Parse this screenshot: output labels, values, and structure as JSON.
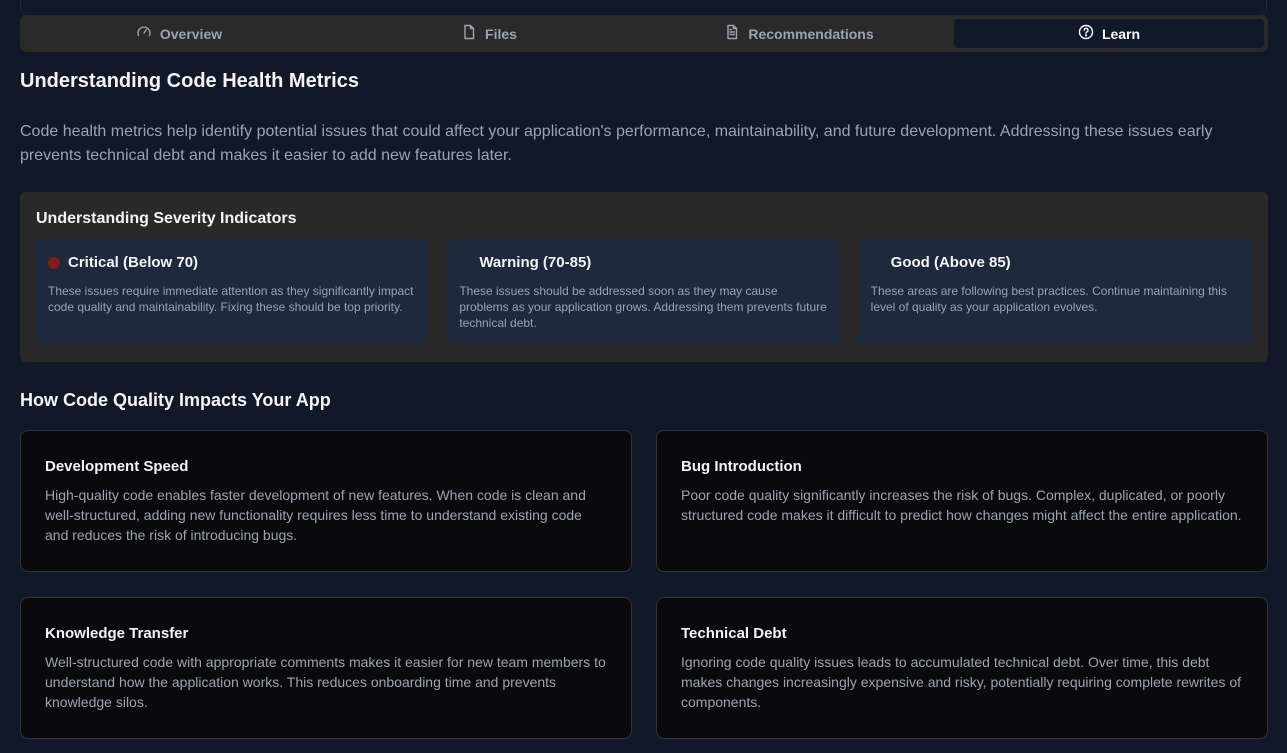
{
  "tabs": [
    {
      "label": "Overview",
      "icon": "gauge-icon",
      "active": false
    },
    {
      "label": "Files",
      "icon": "file-icon",
      "active": false
    },
    {
      "label": "Recommendations",
      "icon": "document-text-icon",
      "active": false
    },
    {
      "label": "Learn",
      "icon": "help-circle-icon",
      "active": true
    }
  ],
  "main": {
    "title": "Understanding Code Health Metrics",
    "intro": "Code health metrics help identify potential issues that could affect your application's performance, maintainability, and future development. Addressing these issues early prevents technical debt and makes it easier to add new features later."
  },
  "severity": {
    "title": "Understanding Severity Indicators",
    "items": [
      {
        "label": "Critical (Below 70)",
        "color": "#7f1d1d",
        "description": "These issues require immediate attention as they significantly impact code quality and maintainability. Fixing these should be top priority."
      },
      {
        "label": "Warning (70-85)",
        "color": "#1e293b",
        "description": "These issues should be addressed soon as they may cause problems as your application grows. Addressing them prevents future technical debt."
      },
      {
        "label": "Good (Above 85)",
        "color": "#1e293b",
        "description": "These areas are following best practices. Continue maintaining this level of quality as your application evolves."
      }
    ]
  },
  "impact": {
    "title": "How Code Quality Impacts Your App",
    "cards": [
      {
        "title": "Development Speed",
        "body": "High-quality code enables faster development of new features. When code is clean and well-structured, adding new functionality requires less time to understand existing code and reduces the risk of introducing bugs."
      },
      {
        "title": "Bug Introduction",
        "body": "Poor code quality significantly increases the risk of bugs. Complex, duplicated, or poorly structured code makes it difficult to predict how changes might affect the entire application."
      },
      {
        "title": "Knowledge Transfer",
        "body": "Well-structured code with appropriate comments makes it easier for new team members to understand how the application works. This reduces onboarding time and prevents knowledge silos."
      },
      {
        "title": "Technical Debt",
        "body": "Ignoring code quality issues leads to accumulated technical debt. Over time, this debt makes changes increasingly expensive and risky, potentially requiring complete rewrites of components."
      }
    ]
  }
}
